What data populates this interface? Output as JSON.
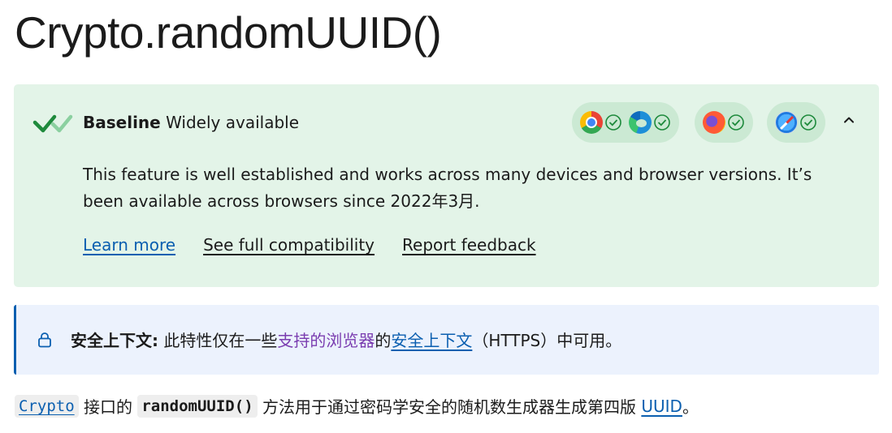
{
  "page": {
    "title": "Crypto.randomUUID()"
  },
  "baseline": {
    "strong": "Baseline",
    "status": "Widely available",
    "description_line1": "This feature is well established and works across many devices and browser versions. It’s",
    "description_line2": "been available across browsers since 2022年3月.",
    "links": {
      "learn_more": "Learn more",
      "full_compat": "See full compatibility",
      "feedback": "Report feedback"
    },
    "browsers": [
      "chrome-icon",
      "edge-icon",
      "firefox-icon",
      "safari-icon"
    ],
    "colors": {
      "background": "#e3f4e8",
      "pill": "#cbe9d3",
      "check": "#1e8a3c"
    }
  },
  "notecard": {
    "label": "安全上下文:",
    "text1": " 此特性仅在一些",
    "link1": "支持的浏览器",
    "text2": "的",
    "link2": "安全上下文",
    "text3": "（HTTPS）中可用。"
  },
  "intro": {
    "crypto_code": "Crypto",
    "text1": " 接口的 ",
    "method_code": "randomUUID()",
    "text2": " 方法用于通过密码学安全的随机数生成器生成第四版 ",
    "uuid_link": "UUID",
    "text3": "。"
  }
}
